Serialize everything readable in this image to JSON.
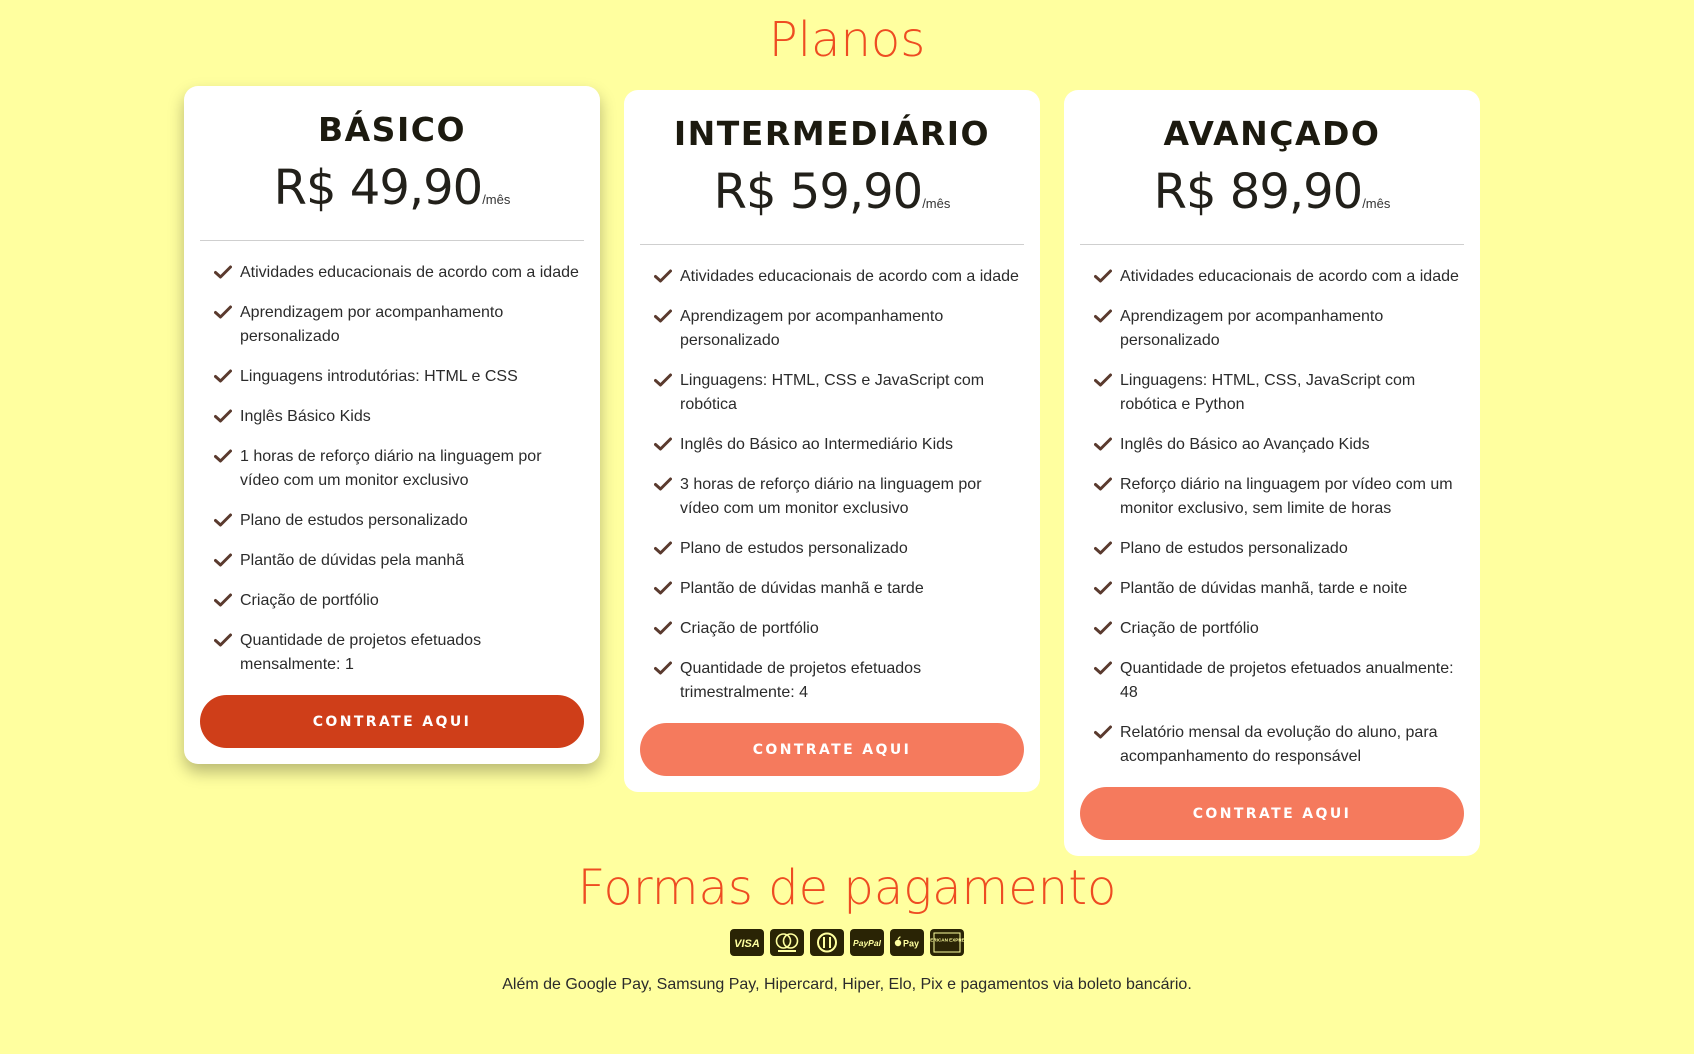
{
  "plans_title": "Planos",
  "payment_title": "Formas de pagamento",
  "plans": [
    {
      "name": "BÁSICO",
      "price": "R$ 49,90",
      "period": "/mês",
      "button": "CONTRATE AQUI",
      "features": [
        "Atividades educacionais de acordo com a idade",
        "Aprendizagem por acompanhamento personalizado",
        "Linguagens introdutórias: HTML e CSS",
        "Inglês Básico Kids",
        "1 horas de reforço diário na linguagem por vídeo com um monitor exclusivo",
        "Plano de estudos personalizado",
        "Plantão de dúvidas pela manhã",
        "Criação de portfólio",
        "Quantidade de projetos efetuados mensalmente: 1"
      ]
    },
    {
      "name": "INTERMEDIÁRIO",
      "price": "R$ 59,90",
      "period": "/mês",
      "button": "CONTRATE AQUI",
      "features": [
        "Atividades educacionais de acordo com a idade",
        "Aprendizagem por acompanhamento personalizado",
        "Linguagens: HTML, CSS e JavaScript com robótica",
        "Inglês do Básico ao Intermediário Kids",
        "3 horas de reforço diário na linguagem por vídeo com um monitor exclusivo",
        "Plano de estudos personalizado",
        "Plantão de dúvidas manhã e tarde",
        "Criação de portfólio",
        "Quantidade de projetos efetuados trimestralmente: 4"
      ]
    },
    {
      "name": "AVANÇADO",
      "price": "R$ 89,90",
      "period": "/mês",
      "button": "CONTRATE AQUI",
      "features": [
        "Atividades educacionais de acordo com a idade",
        "Aprendizagem por acompanhamento personalizado",
        "Linguagens: HTML, CSS, JavaScript com robótica e Python",
        "Inglês do Básico ao Avançado Kids",
        "Reforço diário na linguagem por vídeo com um monitor exclusivo, sem limite de horas",
        "Plano de estudos personalizado",
        "Plantão de dúvidas manhã, tarde e noite",
        "Criação de portfólio",
        "Quantidade de projetos efetuados anualmente: 48",
        "Relatório mensal da evolução do aluno, para acompanhamento do responsável"
      ]
    }
  ],
  "payment_methods": [
    {
      "icon": "visa-icon",
      "label": "VISA"
    },
    {
      "icon": "mastercard-icon",
      "label": ""
    },
    {
      "icon": "diners-club-icon",
      "label": ""
    },
    {
      "icon": "paypal-icon",
      "label": "PayPal"
    },
    {
      "icon": "apple-pay-icon",
      "label": "Pay"
    },
    {
      "icon": "american-express-icon",
      "label": "AMERICAN EXPRESS"
    }
  ],
  "payment_note": "Além de Google Pay, Samsung Pay, Hipercard, Hiper, Elo, Pix e pagamentos via boleto bancário.",
  "colors": {
    "background": "#ffff9f",
    "title": "#ee4c22",
    "button_primary": "#cf3e19",
    "button_secondary": "#f57a5d",
    "check": "#5a3a2e"
  }
}
